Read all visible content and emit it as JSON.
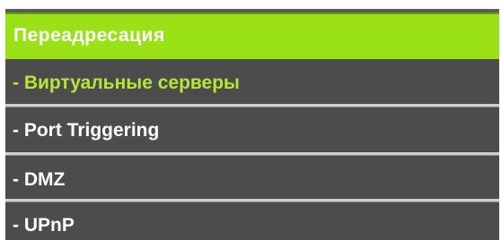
{
  "menu": {
    "header": "Переадресация",
    "items": [
      {
        "label": "- Виртуальные серверы",
        "active": true
      },
      {
        "label": "- Port Triggering",
        "active": false
      },
      {
        "label": "- DMZ",
        "active": false
      },
      {
        "label": "- UPnP",
        "active": false
      }
    ]
  },
  "colors": {
    "header_bg": "#9be117",
    "item_bg": "#4c4c4c",
    "active_text": "#b6e637",
    "text": "#ffffff",
    "divider": "#cfcfcf"
  }
}
